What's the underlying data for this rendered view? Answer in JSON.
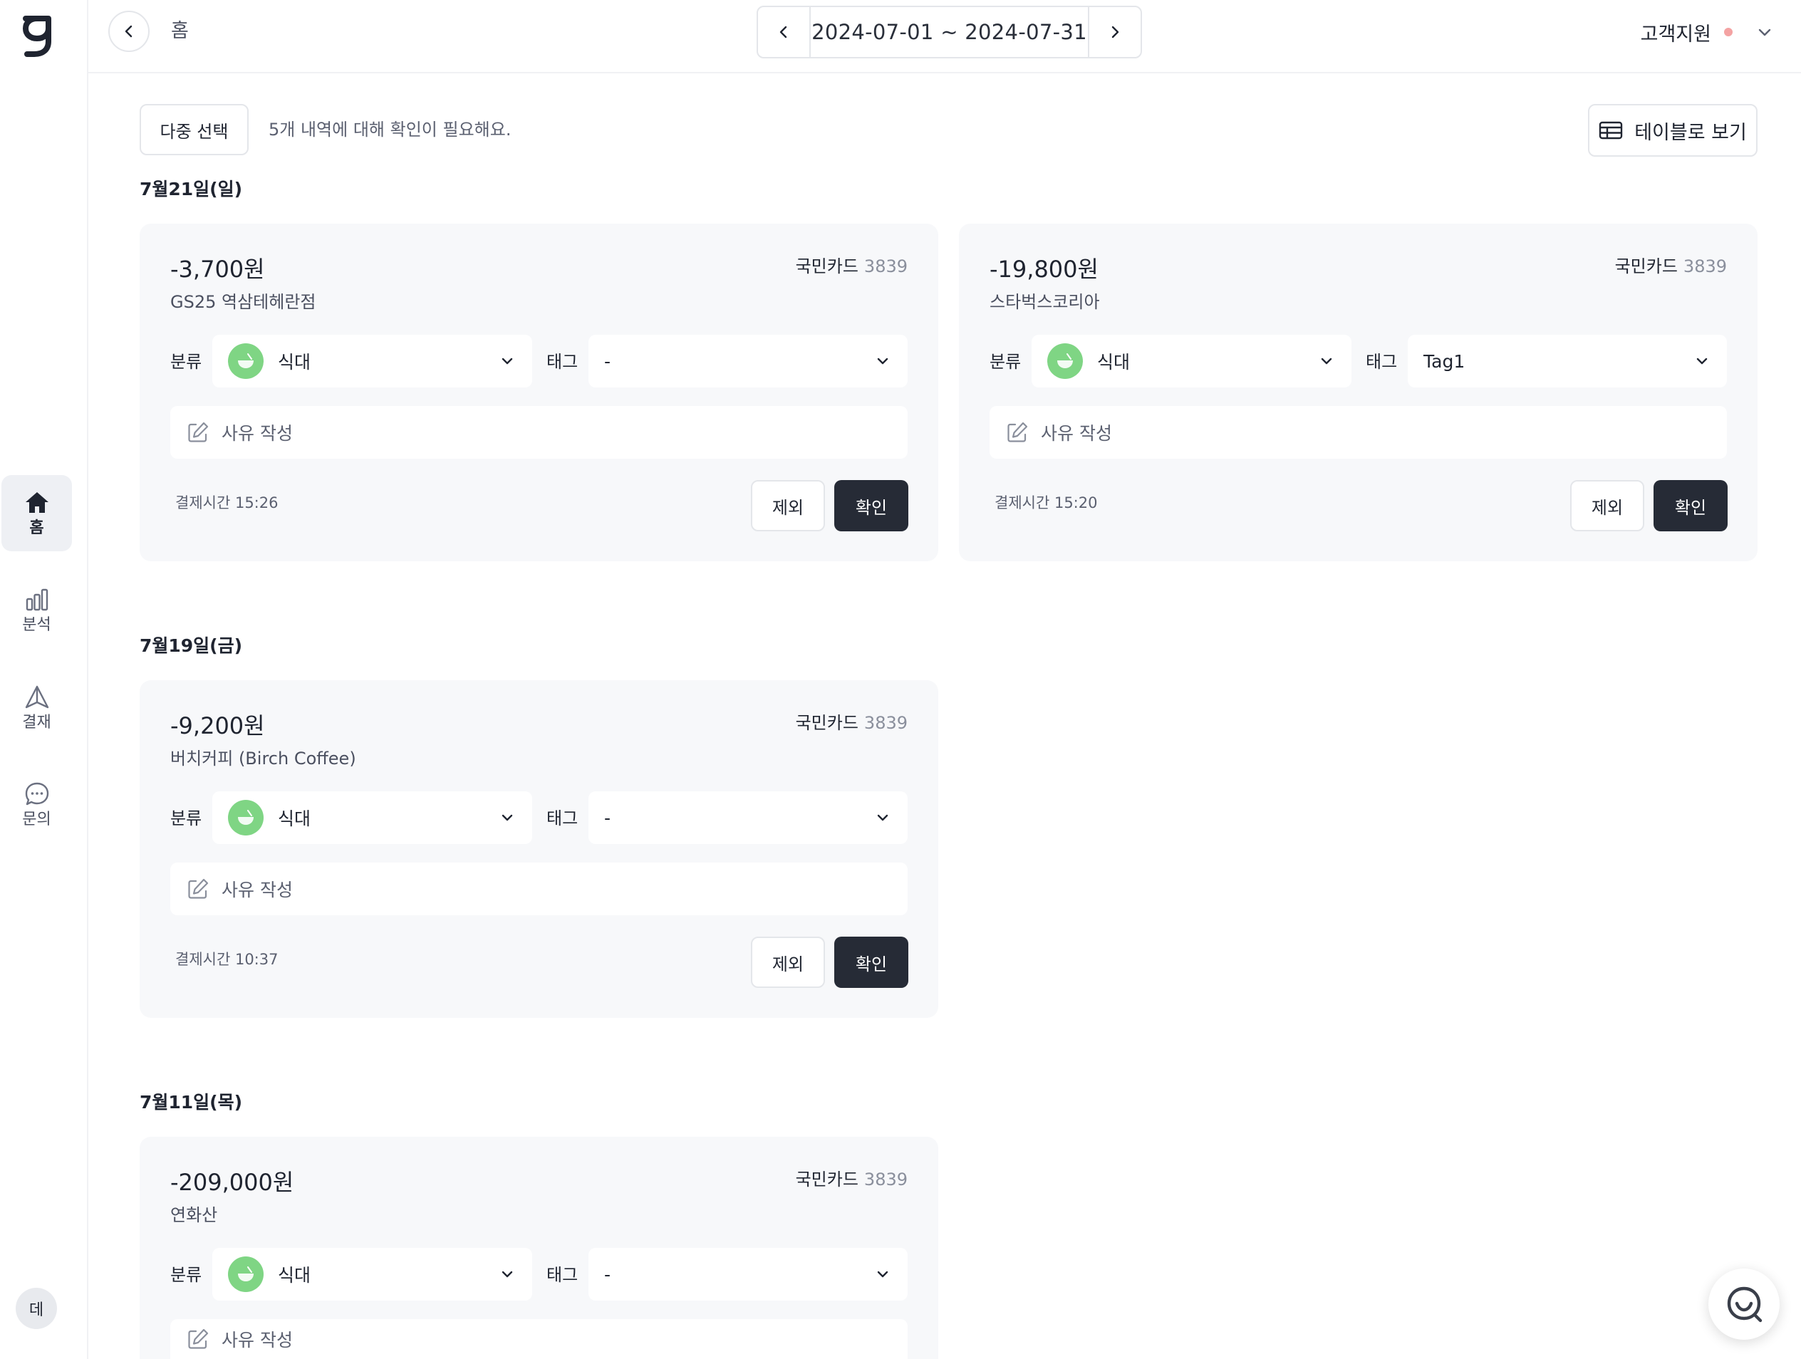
{
  "nav": {
    "items": [
      {
        "label": "홈",
        "icon": "home-icon",
        "active": true
      },
      {
        "label": "분석",
        "icon": "bar-chart-icon",
        "active": false
      },
      {
        "label": "결재",
        "icon": "approval-triangle-icon",
        "active": false
      },
      {
        "label": "문의",
        "icon": "chat-icon",
        "active": false
      }
    ],
    "user_initial": "데"
  },
  "header": {
    "breadcrumb": "홈",
    "date_range": "2024-07-01 ~ 2024-07-31",
    "support_label": "고객지원"
  },
  "toolbar": {
    "multi_select_label": "다중 선택",
    "pending_message": "5개 내역에 대해 확인이 필요해요.",
    "table_view_label": "테이블로 보기"
  },
  "labels": {
    "category": "분류",
    "tag": "태그",
    "memo_placeholder": "사유 작성",
    "exclude": "제외",
    "confirm": "확인"
  },
  "days": [
    {
      "date_label": "7월21일(일)",
      "transactions": [
        {
          "amount": "-3,700원",
          "merchant": "GS25 역삼테헤란점",
          "card_name": "국민카드",
          "card_number": "3839",
          "category": "식대",
          "tag": "-",
          "pay_time": "결제시간 15:26"
        },
        {
          "amount": "-19,800원",
          "merchant": "스타벅스코리아",
          "card_name": "국민카드",
          "card_number": "3839",
          "category": "식대",
          "tag": "Tag1",
          "pay_time": "결제시간 15:20"
        }
      ]
    },
    {
      "date_label": "7월19일(금)",
      "transactions": [
        {
          "amount": "-9,200원",
          "merchant": "버치커피 (Birch Coffee)",
          "card_name": "국민카드",
          "card_number": "3839",
          "category": "식대",
          "tag": "-",
          "pay_time": "결제시간 10:37"
        }
      ]
    },
    {
      "date_label": "7월11일(목)",
      "transactions": [
        {
          "amount": "-209,000원",
          "merchant": "연화산",
          "card_name": "국민카드",
          "card_number": "3839",
          "category": "식대",
          "tag": "-",
          "pay_time": ""
        }
      ]
    }
  ],
  "colors": {
    "accent_dark": "#262b36",
    "category_food": "#7fd584",
    "card_bg": "#f7f8fa",
    "support_dot": "#f4a3a3"
  }
}
